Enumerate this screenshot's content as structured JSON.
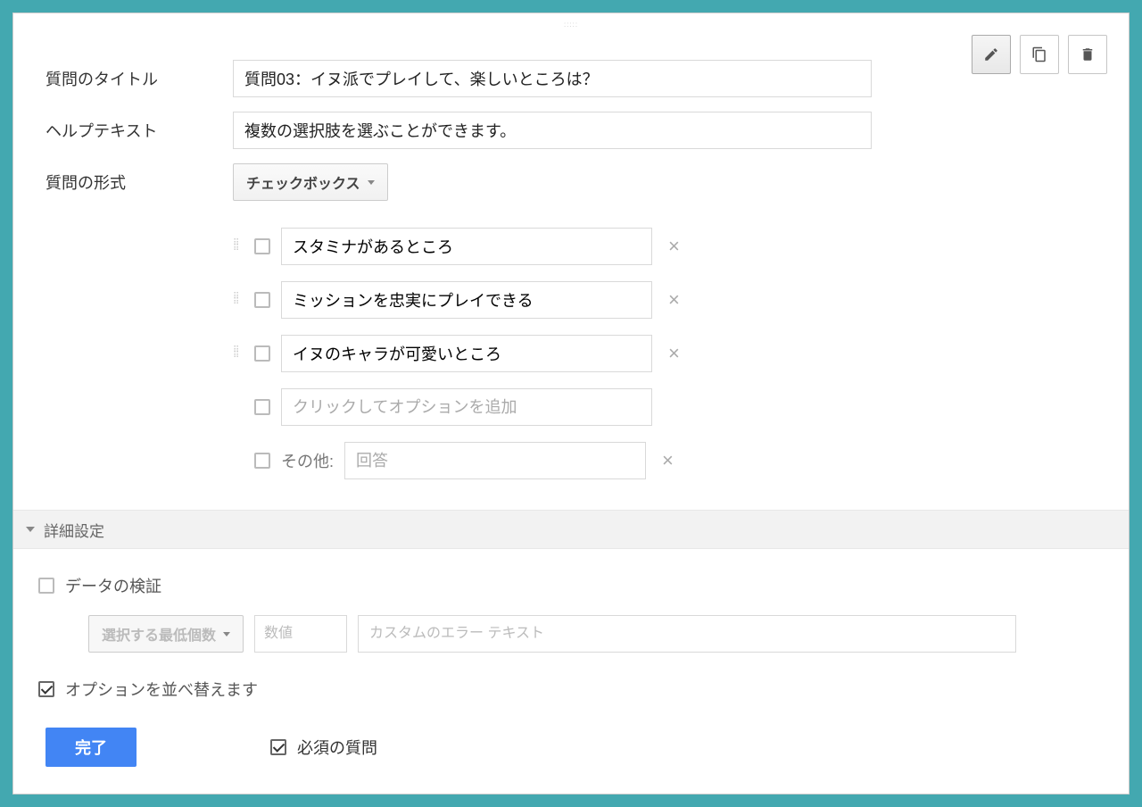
{
  "labels": {
    "title": "質問のタイトル",
    "help": "ヘルプテキスト",
    "type": "質問の形式"
  },
  "values": {
    "title": "質問03：イヌ派でプレイして、楽しいところは？",
    "help": "複数の選択肢を選ぶことができます。",
    "type_label": "チェックボックス"
  },
  "options": [
    "スタミナがあるところ",
    "ミッションを忠実にプレイできる",
    "イヌのキャラが可愛いところ"
  ],
  "add_option_placeholder": "クリックしてオプションを追加",
  "other": {
    "label": "その他:",
    "placeholder": "回答"
  },
  "advanced": {
    "header": "詳細設定",
    "validation_label": "データの検証",
    "validation_type": "選択する最低個数",
    "num_placeholder": "数値",
    "err_placeholder": "カスタムのエラー テキスト",
    "shuffle_label": "オプションを並べ替えます"
  },
  "footer": {
    "done": "完了",
    "required": "必須の質問"
  }
}
